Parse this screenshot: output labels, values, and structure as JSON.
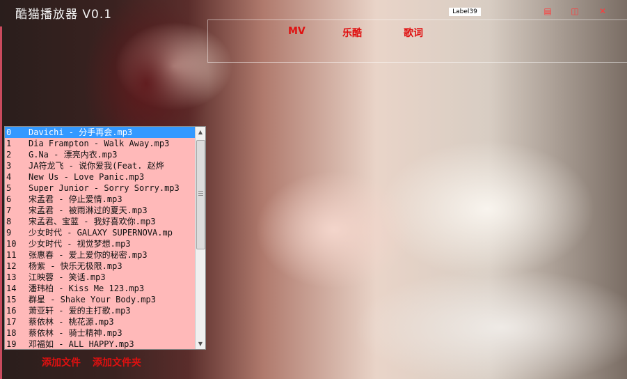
{
  "window": {
    "title": "酷猫播放器 V0.1",
    "label": "Label39",
    "minimize_icon": "minimize-icon",
    "restore_icon": "restore-icon",
    "close_icon": "close-icon"
  },
  "nav": {
    "tabs": [
      "MV",
      "乐酷",
      "歌词"
    ]
  },
  "playlist": {
    "selected_index": 0,
    "items": [
      {
        "index": "0",
        "name": "Davichi - 分手再会.mp3"
      },
      {
        "index": "1",
        "name": "Dia Frampton - Walk Away.mp3"
      },
      {
        "index": "2",
        "name": "G.Na - 漂亮内衣.mp3"
      },
      {
        "index": "3",
        "name": "JA符龙飞 - 说你爱我(Feat. 赵烨"
      },
      {
        "index": "4",
        "name": "New Us - Love Panic.mp3"
      },
      {
        "index": "5",
        "name": "Super Junior - Sorry Sorry.mp3"
      },
      {
        "index": "6",
        "name": "宋孟君 - 停止爱情.mp3"
      },
      {
        "index": "7",
        "name": "宋孟君 - 被雨淋过的夏天.mp3"
      },
      {
        "index": "8",
        "name": "宋孟君、宝蓝 - 我好喜欢你.mp3"
      },
      {
        "index": "9",
        "name": "少女时代 - GALAXY SUPERNOVA.mp"
      },
      {
        "index": "10",
        "name": "少女时代 - 视觉梦想.mp3"
      },
      {
        "index": "11",
        "name": "张惠春 - 爱上爱你的秘密.mp3"
      },
      {
        "index": "12",
        "name": "杨紫 - 快乐无极限.mp3"
      },
      {
        "index": "13",
        "name": "江映蓉 - 笑话.mp3"
      },
      {
        "index": "14",
        "name": "潘玮柏 - Kiss Me 123.mp3"
      },
      {
        "index": "15",
        "name": "群星 - Shake Your Body.mp3"
      },
      {
        "index": "16",
        "name": "萧亚轩 - 爱的主打歌.mp3"
      },
      {
        "index": "17",
        "name": "蔡依林 - 桃花源.mp3"
      },
      {
        "index": "18",
        "name": "蔡依林 - 骑士精神.mp3"
      },
      {
        "index": "19",
        "name": "邓福如 - ALL HAPPY.mp3"
      }
    ]
  },
  "actions": {
    "add_file": "添加文件",
    "add_folder": "添加文件夹"
  },
  "colors": {
    "accent_red": "#e01010",
    "playlist_bg": "#ffb9b9",
    "selection": "#3399ff"
  }
}
